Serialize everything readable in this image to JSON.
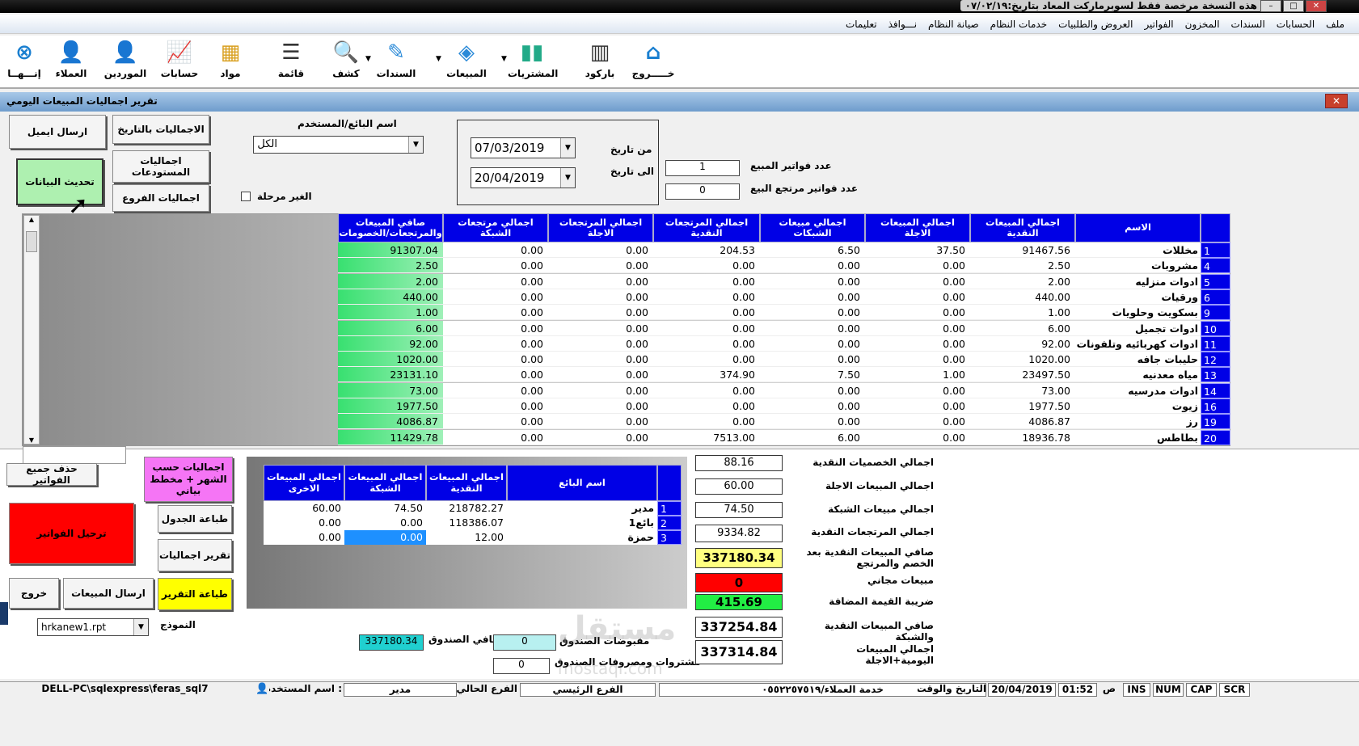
{
  "window": {
    "title": "هذه النسخة مرخصة فقط لسوبرماركت المعاد بتاريخ:٠٧/٠٢/١٩"
  },
  "menu": [
    "ملف",
    "الحسابات",
    "السندات",
    "المخزون",
    "الفواتير",
    "العروض والطلبيات",
    "خدمات النظام",
    "صيانة النظام",
    "نـــوافذ",
    "تعليمات"
  ],
  "toolbar": [
    {
      "label": "خـــــروج",
      "icon": "home-icon",
      "glyph": "⌂",
      "color": "#1a7fd0"
    },
    {
      "label": "باركود",
      "icon": "barcode-icon",
      "glyph": "▥",
      "color": "#333"
    },
    {
      "label": "المشتريات",
      "icon": "books-icon",
      "glyph": "▮▮",
      "color": "#2a8"
    },
    {
      "label": "المبيعات",
      "icon": "tag-icon",
      "glyph": "◈",
      "color": "#2a8ad8"
    },
    {
      "label": "السندات",
      "icon": "cheque-icon",
      "glyph": "✎",
      "color": "#2a8ad8"
    },
    {
      "label": "كشف",
      "icon": "magnifier-icon",
      "glyph": "🔍",
      "color": "#555"
    },
    {
      "label": "قائمة",
      "icon": "list-icon",
      "glyph": "☰",
      "color": "#333"
    },
    {
      "label": "مواد",
      "icon": "boxes-icon",
      "glyph": "▦",
      "color": "#d9a020"
    },
    {
      "label": "حسابات",
      "icon": "chart-board-icon",
      "glyph": "📈",
      "color": "#c33"
    },
    {
      "label": "الموردين",
      "icon": "add-supplier-icon",
      "glyph": "👤",
      "color": "#2a8ad8"
    },
    {
      "label": "العملاء",
      "icon": "add-customer-icon",
      "glyph": "👤",
      "color": "#d9a020"
    },
    {
      "label": "إنـــهــا",
      "icon": "close-circle-icon",
      "glyph": "⊗",
      "color": "#1a7fd0"
    }
  ],
  "form": {
    "title": "تقرير اجماليات المبيعات اليومي",
    "btn_send_email": "ارسال ايميل",
    "btn_totals_by_date": "الاجماليات بالتاريخ",
    "btn_refresh": "تحديث البيانات",
    "btn_warehouse_totals": "اجماليات المستودعات",
    "btn_branch_totals": "اجماليات الفروع",
    "seller_label": "اسم البائع/المستخدم",
    "seller_value": "الكل",
    "unposted_label": "الغير مرحلة",
    "from_label": "من تاريخ",
    "to_label": "الى تاريخ",
    "from_date": "07/03/2019",
    "to_date": "20/04/2019",
    "sales_invoices_label": "عدد فواتير المبيع",
    "sales_invoices_value": "1",
    "return_invoices_label": "عدد فواتير مرتجع البيع",
    "return_invoices_value": "0"
  },
  "main_table": {
    "headers": [
      "",
      "الاسم",
      "اجمالي المبيعات النقدية",
      "اجمالي المبيعات الاجلة",
      "اجمالي مبيعات الشبكات",
      "اجمالي المرتجعات النقدية",
      "اجمالي المرتجعات الاجلة",
      "اجمالي مرتجعات الشبكة",
      "صافي المبيعات والمرتجعات/الخصومات"
    ],
    "rows": [
      [
        "1",
        "مخللات",
        "91467.56",
        "37.50",
        "6.50",
        "204.53",
        "0.00",
        "0.00",
        "91307.04"
      ],
      [
        "4",
        "مشروبات",
        "2.50",
        "0.00",
        "0.00",
        "0.00",
        "0.00",
        "0.00",
        "2.50"
      ],
      [
        "5",
        "ادوات منزليه",
        "2.00",
        "0.00",
        "0.00",
        "0.00",
        "0.00",
        "0.00",
        "2.00"
      ],
      [
        "6",
        "ورقيات",
        "440.00",
        "0.00",
        "0.00",
        "0.00",
        "0.00",
        "0.00",
        "440.00"
      ],
      [
        "9",
        "بسكويت وحلويات",
        "1.00",
        "0.00",
        "0.00",
        "0.00",
        "0.00",
        "0.00",
        "1.00"
      ],
      [
        "10",
        "ادوات تجميل",
        "6.00",
        "0.00",
        "0.00",
        "0.00",
        "0.00",
        "0.00",
        "6.00"
      ],
      [
        "11",
        "ادوات كهربائيه وتلفونات",
        "92.00",
        "0.00",
        "0.00",
        "0.00",
        "0.00",
        "0.00",
        "92.00"
      ],
      [
        "12",
        "حليبات جافه",
        "1020.00",
        "0.00",
        "0.00",
        "0.00",
        "0.00",
        "0.00",
        "1020.00"
      ],
      [
        "13",
        "مياه معدنيه",
        "23497.50",
        "1.00",
        "7.50",
        "374.90",
        "0.00",
        "0.00",
        "23131.10"
      ],
      [
        "14",
        "ادوات مدرسيه",
        "73.00",
        "0.00",
        "0.00",
        "0.00",
        "0.00",
        "0.00",
        "73.00"
      ],
      [
        "16",
        "زيوت",
        "1977.50",
        "0.00",
        "0.00",
        "0.00",
        "0.00",
        "0.00",
        "1977.50"
      ],
      [
        "19",
        "رز",
        "4086.87",
        "0.00",
        "0.00",
        "0.00",
        "0.00",
        "0.00",
        "4086.87"
      ],
      [
        "20",
        "بطاطس",
        "18936.78",
        "0.00",
        "6.00",
        "7513.00",
        "0.00",
        "0.00",
        "11429.78"
      ]
    ]
  },
  "seller_table": {
    "headers": [
      "",
      "اسم البائع",
      "اجمالي المبيعات النقدية",
      "اجمالي المبيعات الشبكة",
      "اجمالي المبيعات الاخرى"
    ],
    "rows": [
      [
        "1",
        "مدير",
        "218782.27",
        "74.50",
        "60.00"
      ],
      [
        "2",
        "بائع1",
        "118386.07",
        "0.00",
        "0.00"
      ],
      [
        "3",
        "حمزة",
        "12.00",
        "0.00",
        "0.00"
      ]
    ]
  },
  "left_buttons": {
    "delete_all": "حذف جميع الفواتير",
    "monthly_chart": "اجماليات حسب الشهر + مخطط بياني",
    "post_invoices": "ترحيل الفواتير",
    "print_table": "طباعة الجدول",
    "totals_report": "تقرير اجماليات",
    "exit": "خروج",
    "send_sales": "ارسال المبيعات",
    "print_report": "طباعة التقرير",
    "template_label": "النموذج",
    "template_value": "hrkanew1.rpt"
  },
  "cashbox": {
    "net_label": "صافي الصندوق",
    "net_value": "337180.34",
    "receipts_label": "مقبوضات الصندوق",
    "receipts_value": "0",
    "expenses_label": "مشتروات ومصروفات الصندوق",
    "expenses_value": "0"
  },
  "summary": [
    {
      "label": "اجمالي الخصميات النقدية",
      "value": "88.16"
    },
    {
      "label": "اجمالي المبيعات الاجلة",
      "value": "60.00"
    },
    {
      "label": "اجمالي مبيعات الشبكة",
      "value": "74.50"
    },
    {
      "label": "اجمالي المرتجعات النقدية",
      "value": "9334.82"
    },
    {
      "label": "صافي المبيعات النقدية بعد الخصم والمرتجع",
      "value": "337180.34",
      "color": "#ffff80"
    },
    {
      "label": "مبيعات مجاني",
      "value": "0",
      "color": "#ff0000"
    },
    {
      "label": "ضريبة القيمة المضافة",
      "value": "415.69",
      "color": "#22ee44"
    },
    {
      "label": "صافي المبيعات النقدية والشبكة",
      "value": "337254.84"
    },
    {
      "label": "اجمالي المبيعات اليومية+الاجلة",
      "value": "337314.84"
    }
  ],
  "statusbar": {
    "server": "DELL-PC\\sqlexpress\\feras_sql7",
    "user_label": ": اسم المستخدم",
    "user": "مدير",
    "current_branch_label": "الفرع الحالي",
    "main_branch": "الفرع الرئيسي",
    "support": "خدمة العملاء/٠٥٥٢٢٥٧٥١٩",
    "datetime_label": "التاريخ والوقت",
    "date": "20/04/2019",
    "time": "01:52",
    "ampm": "ص",
    "keys": [
      "INS",
      "NUM",
      "CAP",
      "SCR"
    ]
  },
  "watermark": "mostaql.com"
}
